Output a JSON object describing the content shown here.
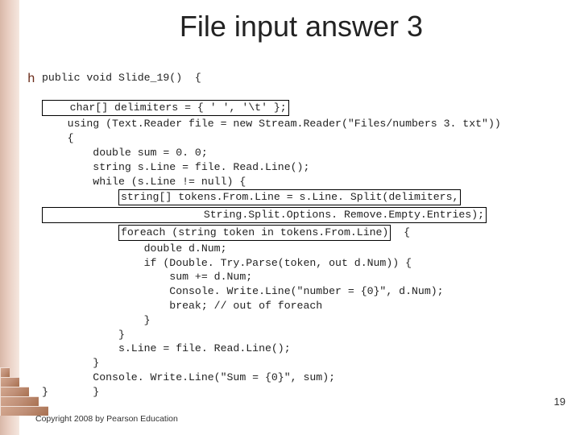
{
  "title": "File input answer 3",
  "bullet_glyph": "h",
  "code": {
    "l01": "public void Slide_19()  {",
    "l02": "    char[] delimiters = { ' ', '\\t' };",
    "l03": "    using (Text.Reader file = new Stream.Reader(\"Files/numbers 3. txt\"))",
    "l04": "    {",
    "l05": "        double sum = 0. 0;",
    "l06": "        string s.Line = file. Read.Line();",
    "l07": "        while (s.Line != null) {",
    "l08a": "            ",
    "l08b": "string[] tokens.From.Line = s.Line. Split(delimiters,",
    "l09a": "                         String.Split.Options. Remove.Empty.Entries);",
    "l10a": "            ",
    "l10b": "foreach (string token in tokens.From.Line)",
    "l10c": "  {",
    "l11": "                double d.Num;",
    "l12": "                if (Double. Try.Parse(token, out d.Num)) {",
    "l13": "                    sum += d.Num;",
    "l14": "                    Console. Write.Line(\"number = {0}\", d.Num);",
    "l15": "                    break; // out of foreach",
    "l16": "                }",
    "l17": "            }",
    "l18": "            s.Line = file. Read.Line();",
    "l19": "        }",
    "l20": "        Console. Write.Line(\"Sum = {0}\", sum);",
    "l21": "}       }"
  },
  "page_number": "19",
  "copyright": "Copyright 2008 by Pearson Education"
}
